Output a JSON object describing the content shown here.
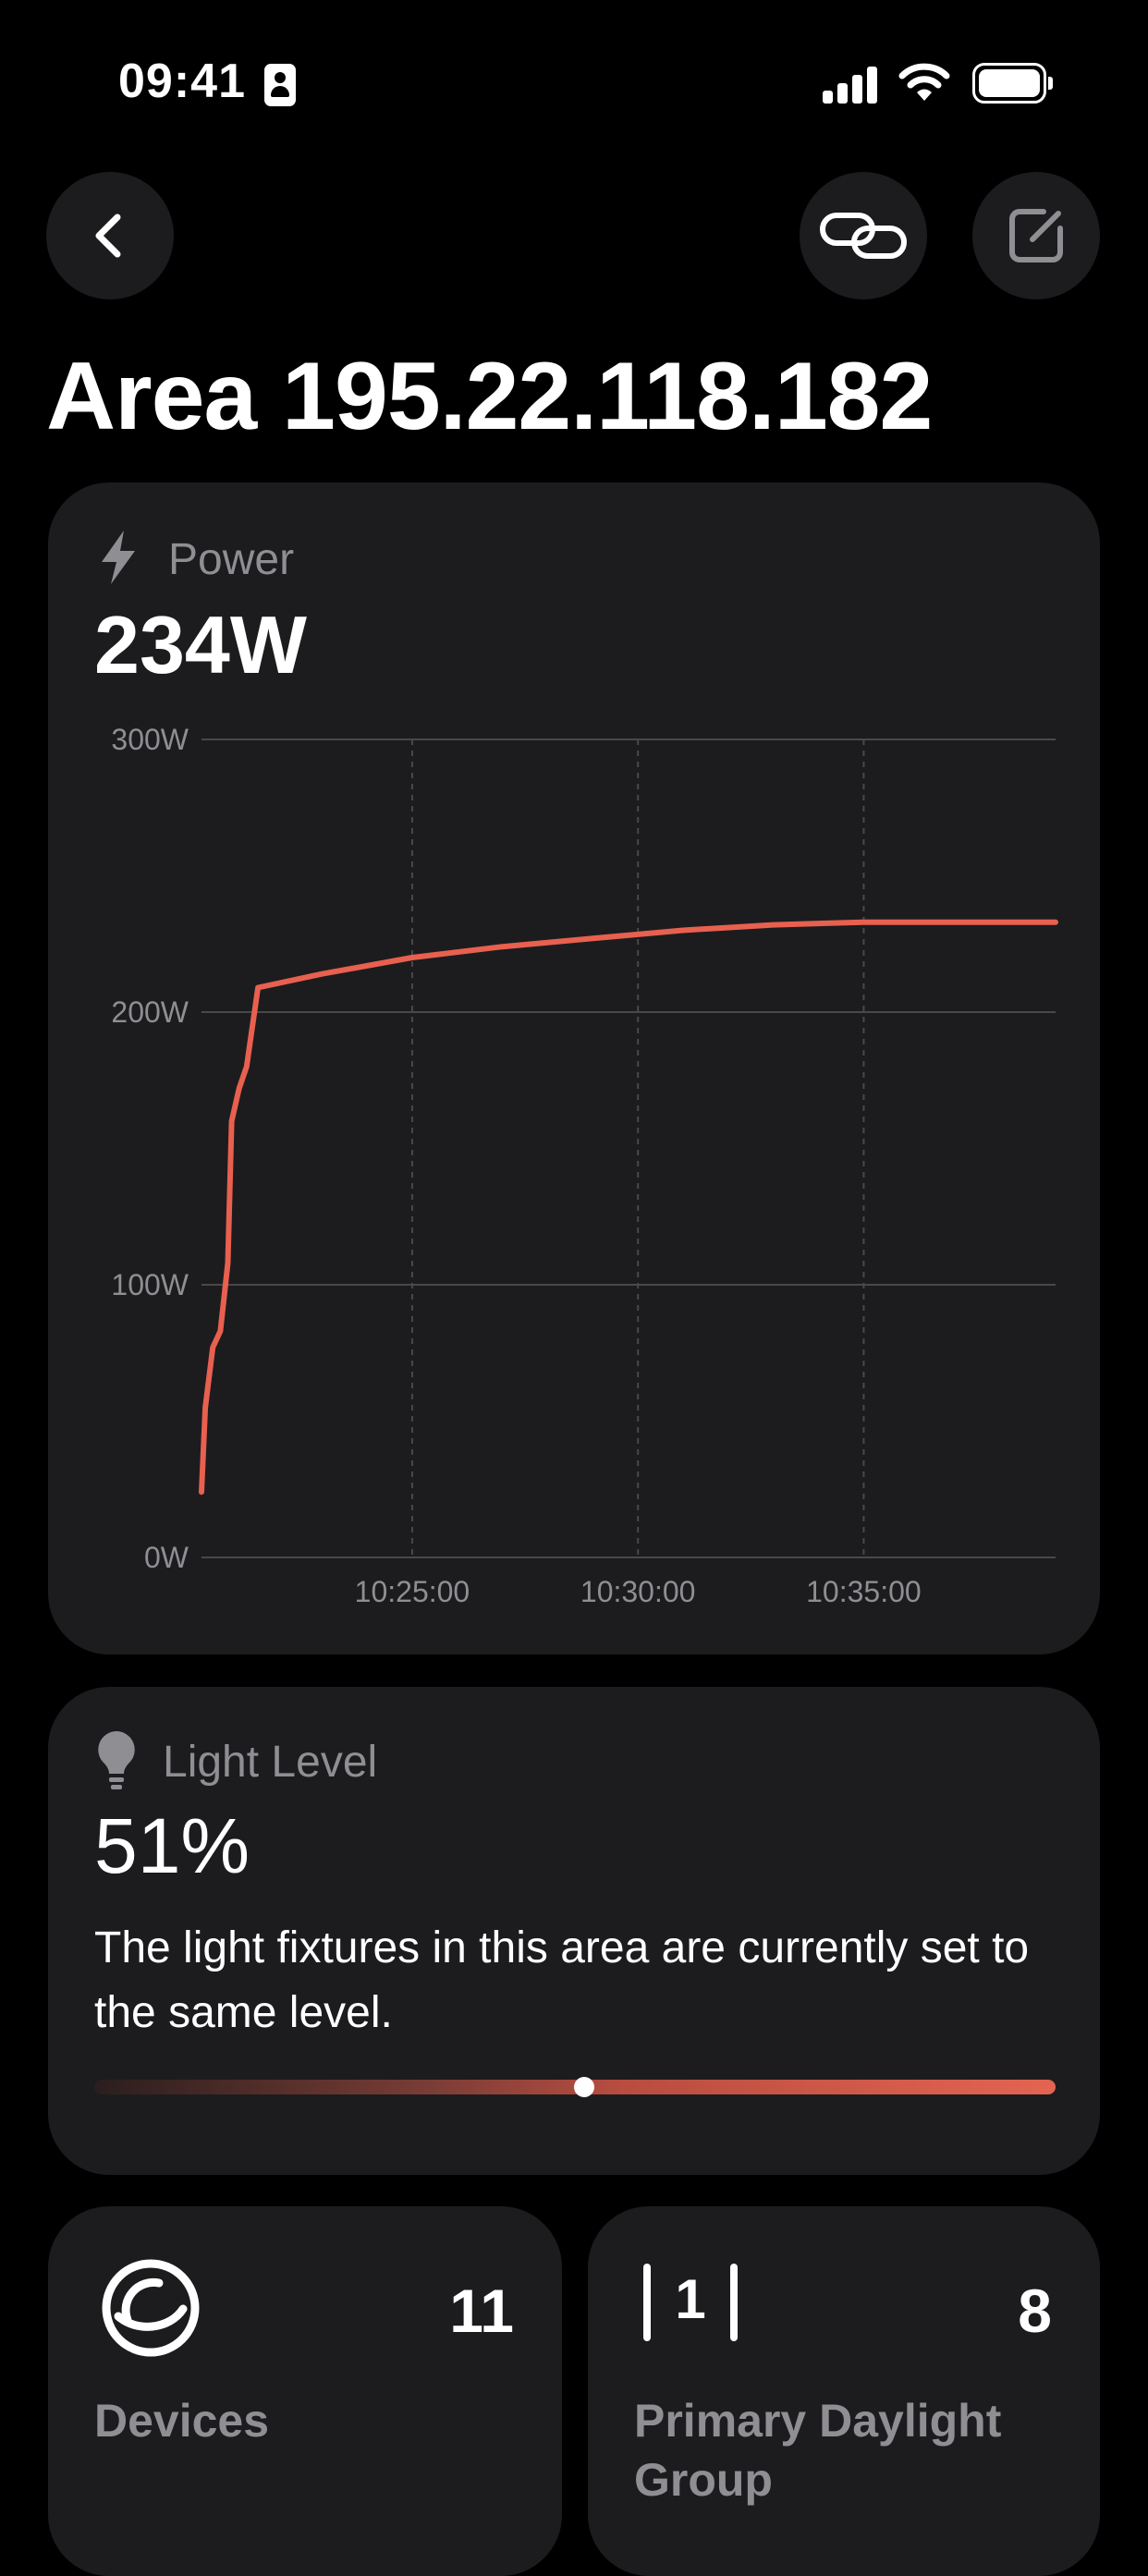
{
  "status_bar": {
    "time": "09:41"
  },
  "header": {
    "title": "Area 195.22.118.182"
  },
  "power": {
    "label": "Power",
    "value": "234W"
  },
  "chart_data": {
    "type": "line",
    "ylim": [
      0,
      300
    ],
    "y_ticks": [
      "300W",
      "200W",
      "100W",
      "0W"
    ],
    "y_tick_values": [
      300,
      200,
      100,
      0
    ],
    "x_ticks": [
      "10:25:00",
      "10:30:00",
      "10:35:00"
    ],
    "x_tick_values": [
      "10:25:00",
      "10:30:00",
      "10:35:00"
    ],
    "xlim": [
      "10:20:20",
      "10:39:15"
    ],
    "grid": true,
    "series": [
      {
        "color": "#e8604f",
        "points": [
          [
            "10:20:20",
            24
          ],
          [
            "10:20:25",
            55
          ],
          [
            "10:20:35",
            77
          ],
          [
            "10:20:45",
            83
          ],
          [
            "10:20:55",
            108
          ],
          [
            "10:21:00",
            160
          ],
          [
            "10:21:10",
            172
          ],
          [
            "10:21:20",
            180
          ],
          [
            "10:21:35",
            209
          ],
          [
            "10:23:00",
            214
          ],
          [
            "10:25:00",
            220
          ],
          [
            "10:27:00",
            224
          ],
          [
            "10:29:00",
            227
          ],
          [
            "10:31:00",
            230
          ],
          [
            "10:33:00",
            232
          ],
          [
            "10:35:00",
            233
          ],
          [
            "10:37:00",
            233
          ],
          [
            "10:39:15",
            233
          ]
        ]
      }
    ]
  },
  "light_level": {
    "label": "Light Level",
    "value": "51%",
    "description": "The light fixtures in this area are currently set to the same level.",
    "level_percent": 51
  },
  "tiles": {
    "devices": {
      "count": "11",
      "label": "Devices"
    },
    "daylight_group": {
      "count": "8",
      "badge": "1",
      "label": "Primary Daylight Group"
    }
  },
  "colors": {
    "accent": "#e8604f",
    "card_bg": "#1c1c1e",
    "secondary_text": "#8e8e93"
  }
}
